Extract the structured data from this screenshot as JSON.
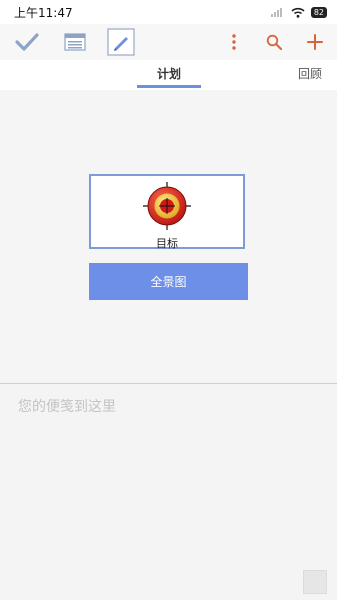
{
  "status_bar": {
    "time": "上午11:47",
    "battery": "82"
  },
  "toolbar": {
    "icons": [
      "checkmark-icon",
      "calendar-icon",
      "edit-icon",
      "more-icon",
      "search-icon",
      "add-icon"
    ],
    "accent_color": "#d9643c",
    "inactive_color": "#8fa3c8"
  },
  "tabs": {
    "plan": "计划",
    "review": "回顾"
  },
  "main": {
    "goal_label": "目标",
    "panorama_button": "全景图"
  },
  "notes": {
    "placeholder": "您的便笺到这里"
  }
}
